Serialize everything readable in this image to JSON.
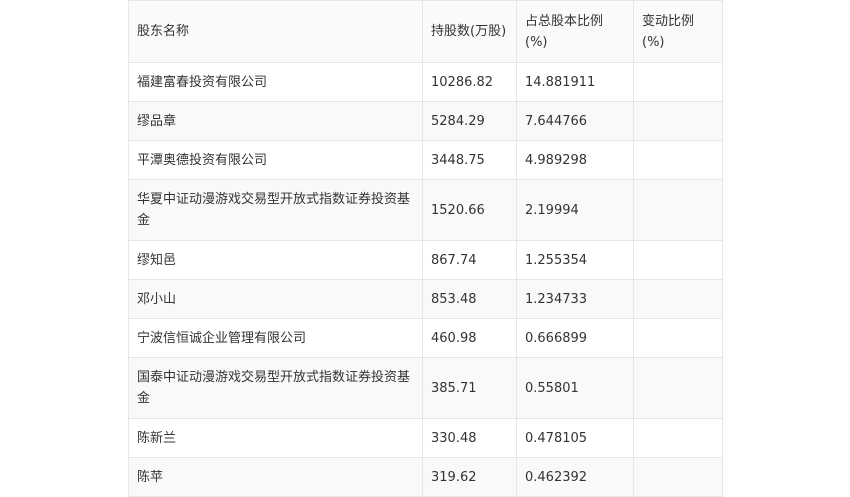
{
  "table": {
    "headers": [
      "股东名称",
      "持股数(万股)",
      "占总股本比例(%)",
      "变动比例(%)"
    ],
    "rows": [
      {
        "name": "福建富春投资有限公司",
        "shares": "10286.82",
        "ratio": "14.881911",
        "change": ""
      },
      {
        "name": "缪品章",
        "shares": "5284.29",
        "ratio": "7.644766",
        "change": ""
      },
      {
        "name": "平潭奥德投资有限公司",
        "shares": "3448.75",
        "ratio": "4.989298",
        "change": ""
      },
      {
        "name": "华夏中证动漫游戏交易型开放式指数证券投资基金",
        "shares": "1520.66",
        "ratio": "2.19994",
        "change": ""
      },
      {
        "name": "缪知邑",
        "shares": "867.74",
        "ratio": "1.255354",
        "change": ""
      },
      {
        "name": "邓小山",
        "shares": "853.48",
        "ratio": "1.234733",
        "change": ""
      },
      {
        "name": "宁波信恒诚企业管理有限公司",
        "shares": "460.98",
        "ratio": "0.666899",
        "change": ""
      },
      {
        "name": "国泰中证动漫游戏交易型开放式指数证券投资基金",
        "shares": "385.71",
        "ratio": "0.55801",
        "change": ""
      },
      {
        "name": "陈新兰",
        "shares": "330.48",
        "ratio": "0.478105",
        "change": ""
      },
      {
        "name": "陈苹",
        "shares": "319.62",
        "ratio": "0.462392",
        "change": ""
      }
    ]
  }
}
